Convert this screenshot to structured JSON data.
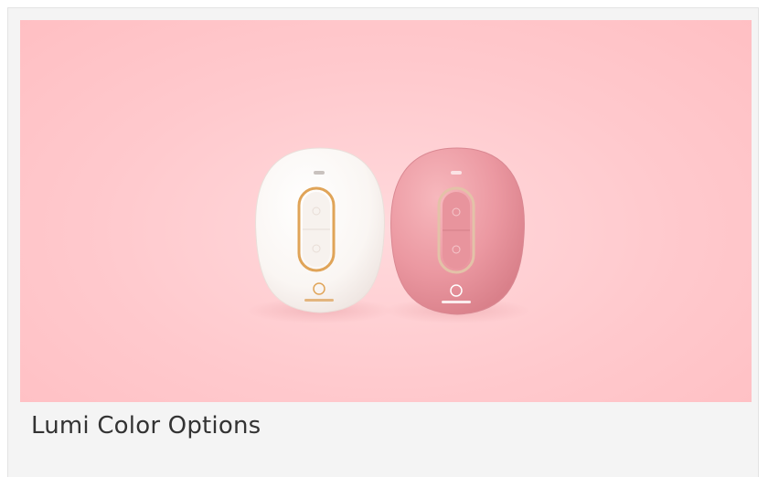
{
  "caption": "Lumi Color Options",
  "photo": {
    "alt": "Two Lumi devices, white and pink, on a pink backdrop",
    "devices": [
      {
        "color_name": "white",
        "body_color": "#fbf8f5",
        "trim_color": "#e0a458"
      },
      {
        "color_name": "pink",
        "body_color": "#ec9aa2",
        "trim_color": "#d9b99a"
      }
    ]
  },
  "colors": {
    "backdrop": "#ffc9cd",
    "caption_text": "#333333",
    "card_bg": "#f4f4f4"
  }
}
